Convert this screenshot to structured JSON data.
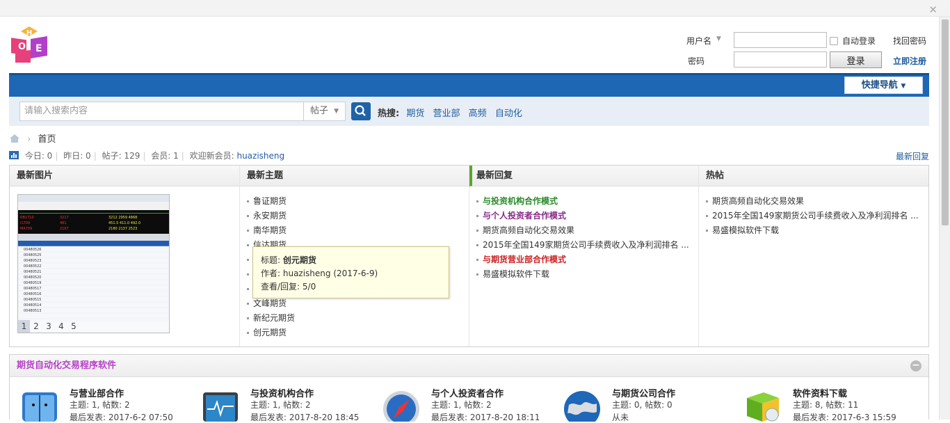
{
  "login": {
    "username_label": "用户名",
    "password_label": "密码",
    "auto_login_label": "自动登录",
    "forgot_password": "找回密码",
    "login_button": "登录",
    "register": "立即注册"
  },
  "nav": {
    "quick_nav": "快捷导航"
  },
  "search": {
    "placeholder": "请输入搜索内容",
    "type_selected": "帖子",
    "hot_label": "热搜:",
    "hot_terms": [
      "期货",
      "营业部",
      "高频",
      "自动化"
    ]
  },
  "breadcrumb": {
    "home": "首页"
  },
  "stats": {
    "today": "今日: 0",
    "yesterday": "昨日: 0",
    "posts": "帖子: 129",
    "members": "会员: 1",
    "welcome": "欢迎新会员:",
    "newest_member": "huazisheng",
    "latest_reply_link": "最新回复"
  },
  "panel": {
    "images_title": "最新图片",
    "image_pages": [
      "1",
      "2",
      "3",
      "4",
      "5"
    ],
    "topics_title": "最新主题",
    "topics": [
      "鲁证期货",
      "永安期货",
      "南华期货",
      "信达期货",
      "",
      "",
      "",
      "文峰期货",
      "新纪元期货",
      "创元期货"
    ],
    "replies_title": "最新回复",
    "replies": [
      {
        "text": "与投资机构合作模式",
        "color": "#2a8a2a"
      },
      {
        "text": "与个人投资者合作模式",
        "color": "#8a2a8a"
      },
      {
        "text": "期货高频自动化交易效果",
        "color": "#333333"
      },
      {
        "text": "2015年全国149家期货公司手续费收入及净利润排名 ...",
        "color": "#333333"
      },
      {
        "text": "与期货营业部合作模式",
        "color": "#cc2222"
      },
      {
        "text": "易盛模拟软件下载",
        "color": "#333333"
      }
    ],
    "hot_title": "热帖",
    "hot": [
      "期货高频自动化交易效果",
      "2015年全国149家期货公司手续费收入及净利润排名 ...",
      "易盛模拟软件下载"
    ]
  },
  "tooltip": {
    "title_label": "标题:",
    "title": "创元期货",
    "author": "作者: huazisheng (2017-6-9)",
    "views": "查看/回复: 5/0"
  },
  "forum_section": {
    "title": "期货自动化交易程序软件",
    "forums": [
      {
        "name": "与营业部合作",
        "stats": "主题: 1, 帖数: 2",
        "last": "最后发表: 2017-6-2 07:50",
        "icon": "finder-icon"
      },
      {
        "name": "与投资机构合作",
        "stats": "主题: 1, 帖数: 2",
        "last": "最后发表: 2017-8-20 18:45",
        "icon": "monitor-icon"
      },
      {
        "name": "与个人投资者合作",
        "stats": "主题: 1, 帖数: 2",
        "last": "最后发表: 2017-8-20 18:11",
        "icon": "compass-icon"
      },
      {
        "name": "与期货公司合作",
        "stats": "主题: 0, 帖数: 0",
        "last": "从未",
        "icon": "globe-icon"
      },
      {
        "name": "软件资料下载",
        "stats": "主题: 8, 帖数: 11",
        "last": "最后发表: 2017-6-3 15:59",
        "icon": "software-box-icon"
      }
    ]
  }
}
